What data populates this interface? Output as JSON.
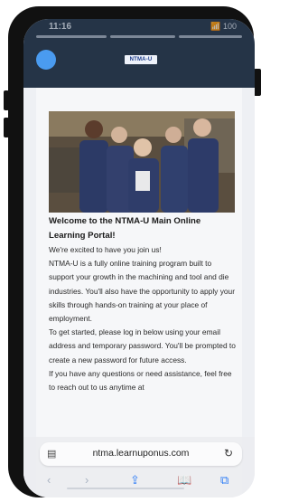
{
  "status_bar": {
    "time": "11:16",
    "icons": "📶 100"
  },
  "header": {
    "logo_text": "NTMA-U"
  },
  "content": {
    "title": "Welcome to the NTMA-U Main Online Learning Portal!",
    "paragraphs": [
      "We're excited to have you join us!",
      "NTMA-U is a fully online training program built to support your growth in the machining and tool and die industries. You'll also have the opportunity to apply your skills through hands-on training at your place of employment.",
      "To get started, please log in below using your email address and temporary password. You'll be prompted to create a new password for future access.",
      "If you have any questions or need assistance, feel free to reach out to us anytime at"
    ]
  },
  "browser": {
    "url": "ntma.learnuponus.com",
    "reader_icon": "reader-mode-icon",
    "reload_icon": "reload-icon",
    "nav_icons": [
      "back-icon",
      "forward-icon",
      "share-icon",
      "bookmarks-icon",
      "tabs-icon"
    ]
  },
  "colors": {
    "header_bg": "#253447",
    "avatar": "#4a9bf0",
    "accent": "#2f7df6"
  }
}
